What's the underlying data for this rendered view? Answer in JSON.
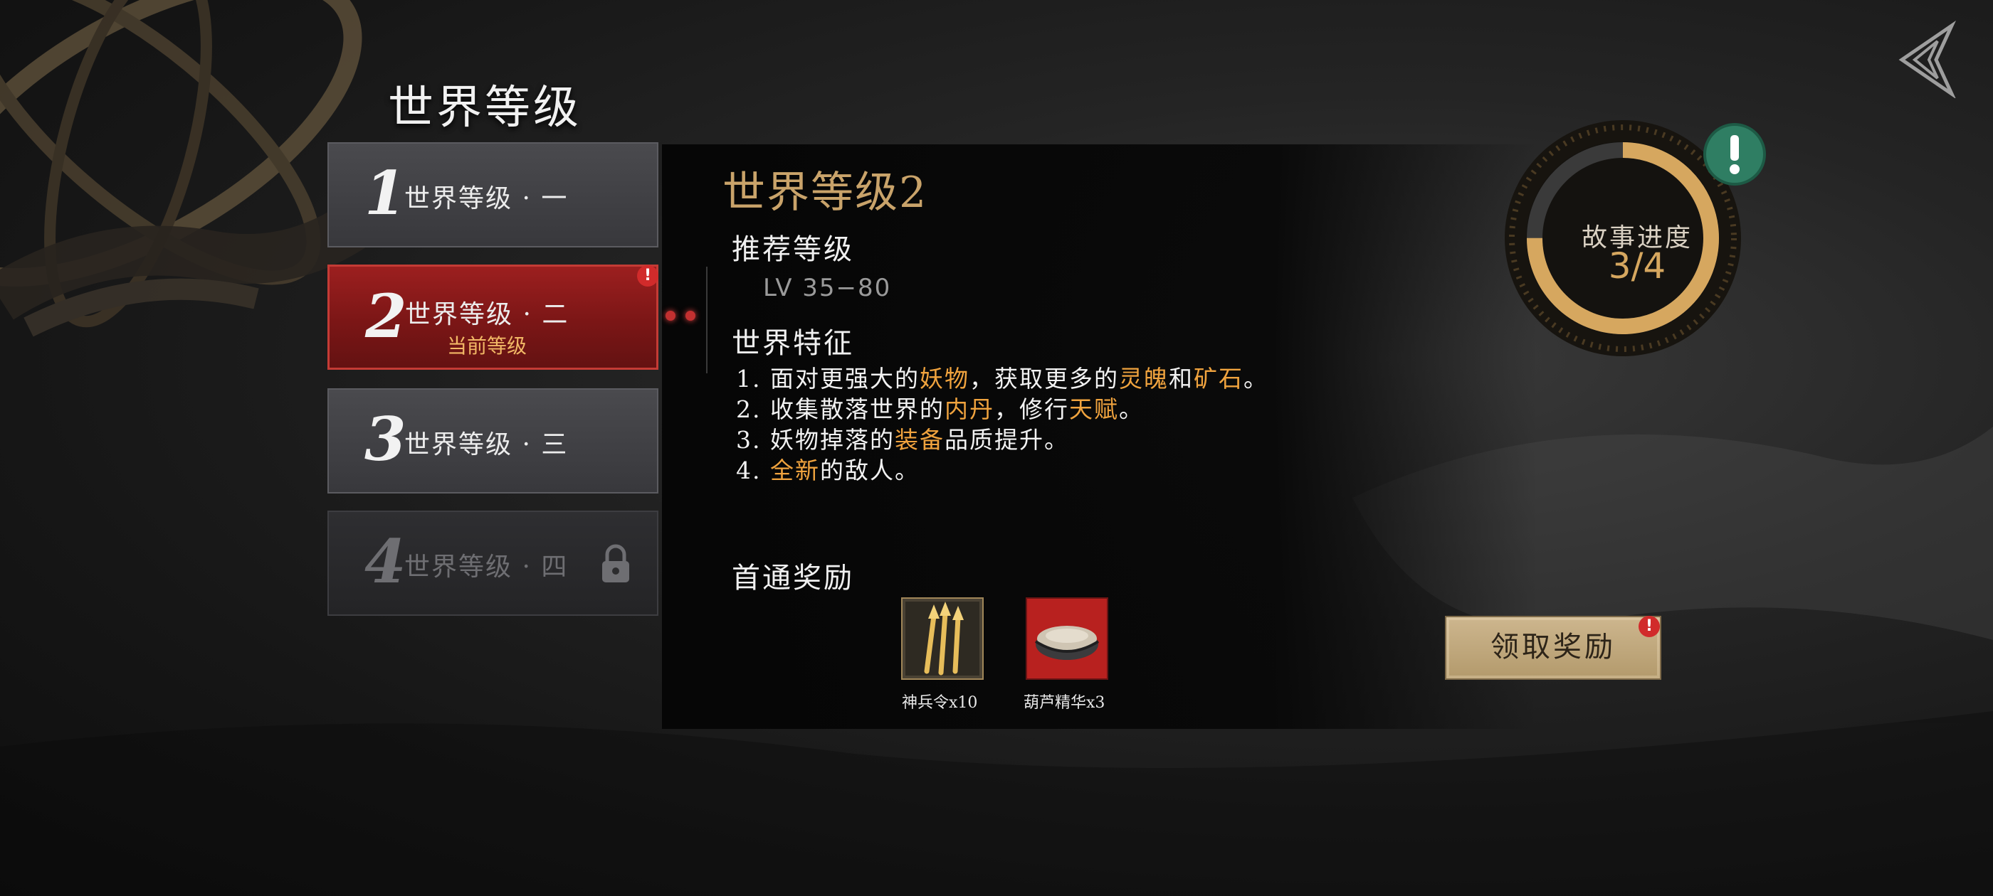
{
  "page_title": "世界等级",
  "levels": [
    {
      "num": "1",
      "label": "世界等级 · 一",
      "sub": ""
    },
    {
      "num": "2",
      "label": "世界等级 · 二",
      "sub": "当前等级"
    },
    {
      "num": "3",
      "label": "世界等级 · 三",
      "sub": ""
    },
    {
      "num": "4",
      "label": "世界等级 · 四",
      "sub": ""
    }
  ],
  "detail": {
    "title": "世界等级2",
    "recommend_head": "推荐等级",
    "recommend_value": "LV 35−80",
    "features_head": "世界特征",
    "features": [
      [
        {
          "t": "1. 面对更强大的"
        },
        {
          "t": "妖物",
          "h": true
        },
        {
          "t": "，获取更多的"
        },
        {
          "t": "灵魄",
          "h": true
        },
        {
          "t": "和"
        },
        {
          "t": "矿石",
          "h": true
        },
        {
          "t": "。"
        }
      ],
      [
        {
          "t": "2. 收集散落世界的"
        },
        {
          "t": "内丹",
          "h": true
        },
        {
          "t": "，修行"
        },
        {
          "t": "天赋",
          "h": true
        },
        {
          "t": "。"
        }
      ],
      [
        {
          "t": "3. 妖物掉落的"
        },
        {
          "t": "装备",
          "h": true
        },
        {
          "t": "品质提升。"
        }
      ],
      [
        {
          "t": "4. "
        },
        {
          "t": "全新",
          "h": true
        },
        {
          "t": "的敌人。"
        }
      ]
    ],
    "reward_head": "首通奖励",
    "rewards": [
      {
        "name": "神兵令x10",
        "icon": "golden-spears-icon"
      },
      {
        "name": "葫芦精华x3",
        "icon": "powder-bowl-icon"
      }
    ],
    "claim_label": "领取奖励"
  },
  "progress": {
    "label": "故事进度",
    "value": "3/4",
    "fraction": 0.75
  },
  "colors": {
    "accent_gold": "#c9a36a",
    "highlight_orange": "#f0a33e",
    "active_red": "#8a1b1b",
    "progress_gold": "#d6a75f",
    "alert_green": "#2f7e63",
    "badge_red": "#d12b2b"
  },
  "icons": {
    "back": "back-arrow-icon",
    "lock": "lock-icon",
    "alert": "exclamation-icon",
    "red_badge": "red-exclamation-badge"
  }
}
